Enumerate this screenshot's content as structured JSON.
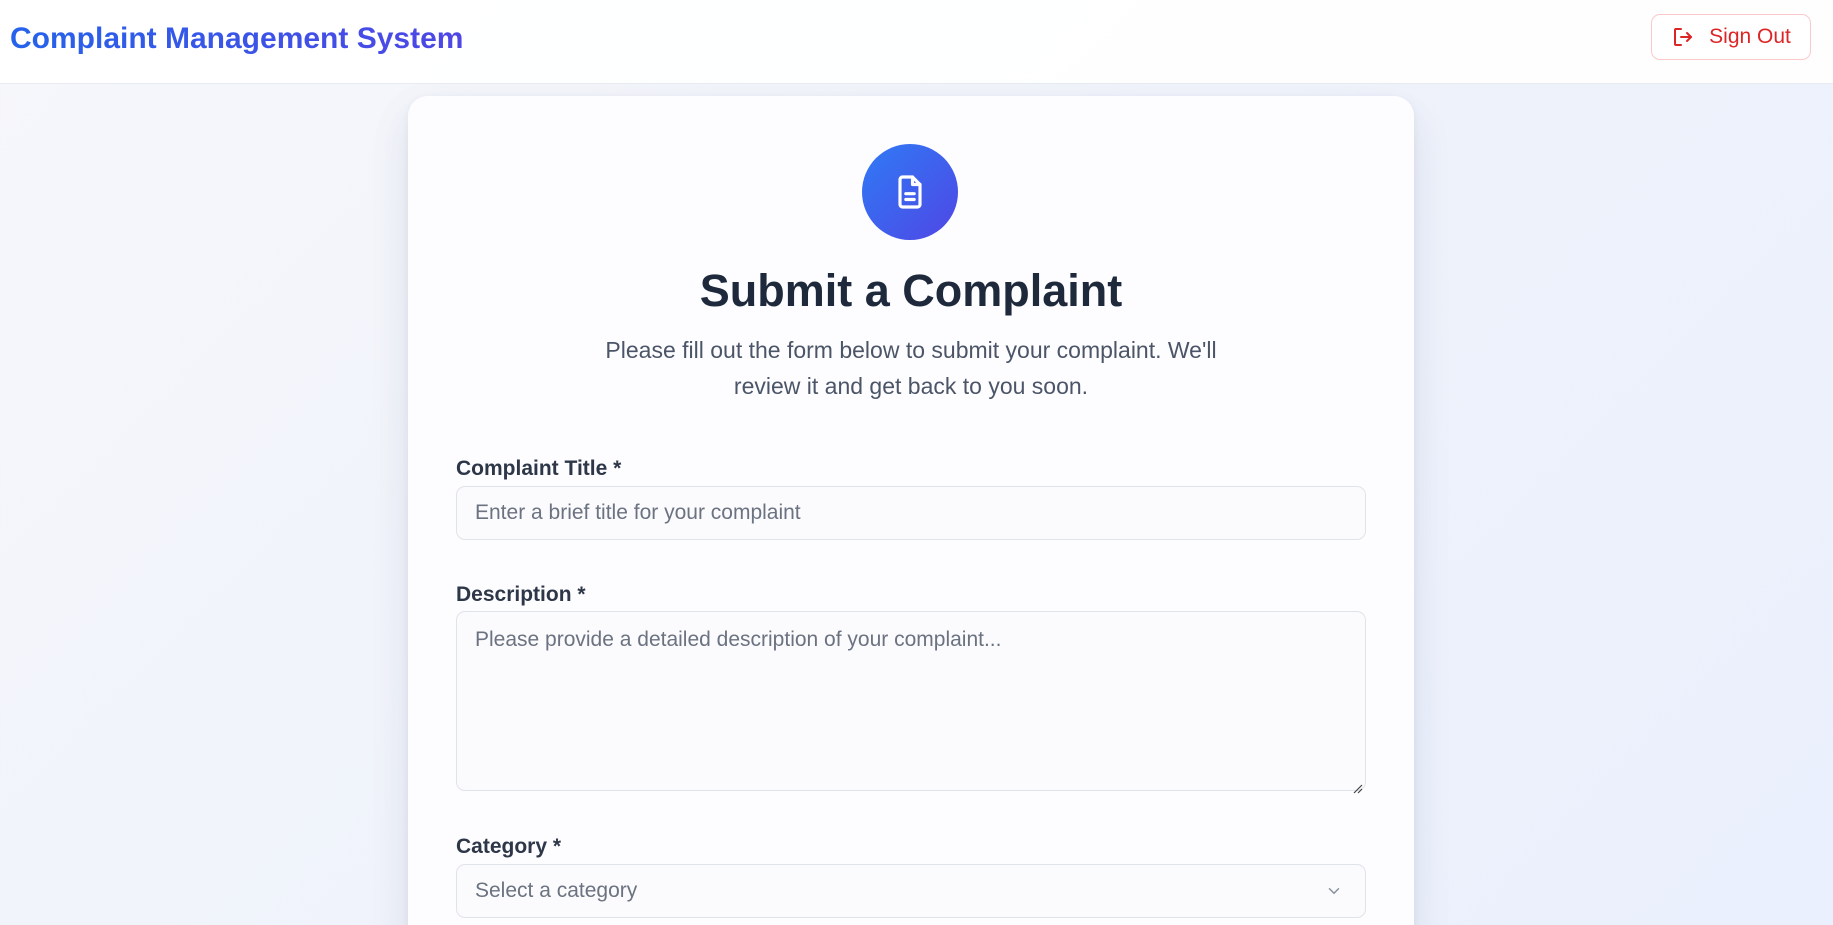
{
  "header": {
    "app_title": "Complaint Management System",
    "signout_label": "Sign Out"
  },
  "form": {
    "heading": "Submit a Complaint",
    "subtitle": "Please fill out the form below to submit your complaint. We'll review it and get back to you soon.",
    "title_field": {
      "label": "Complaint Title *",
      "placeholder": "Enter a brief title for your complaint"
    },
    "description_field": {
      "label": "Description *",
      "placeholder": "Please provide a detailed description of your complaint..."
    },
    "category_field": {
      "label": "Category *",
      "selected": "Select a category"
    }
  },
  "colors": {
    "brand_gradient_start": "#2563eb",
    "brand_gradient_end": "#4f46e5",
    "signout_red": "#dc2626",
    "heading_text": "#1e293b"
  },
  "icons": {
    "signout": "log-out-icon",
    "badge": "document-icon",
    "select": "chevron-down-icon"
  }
}
